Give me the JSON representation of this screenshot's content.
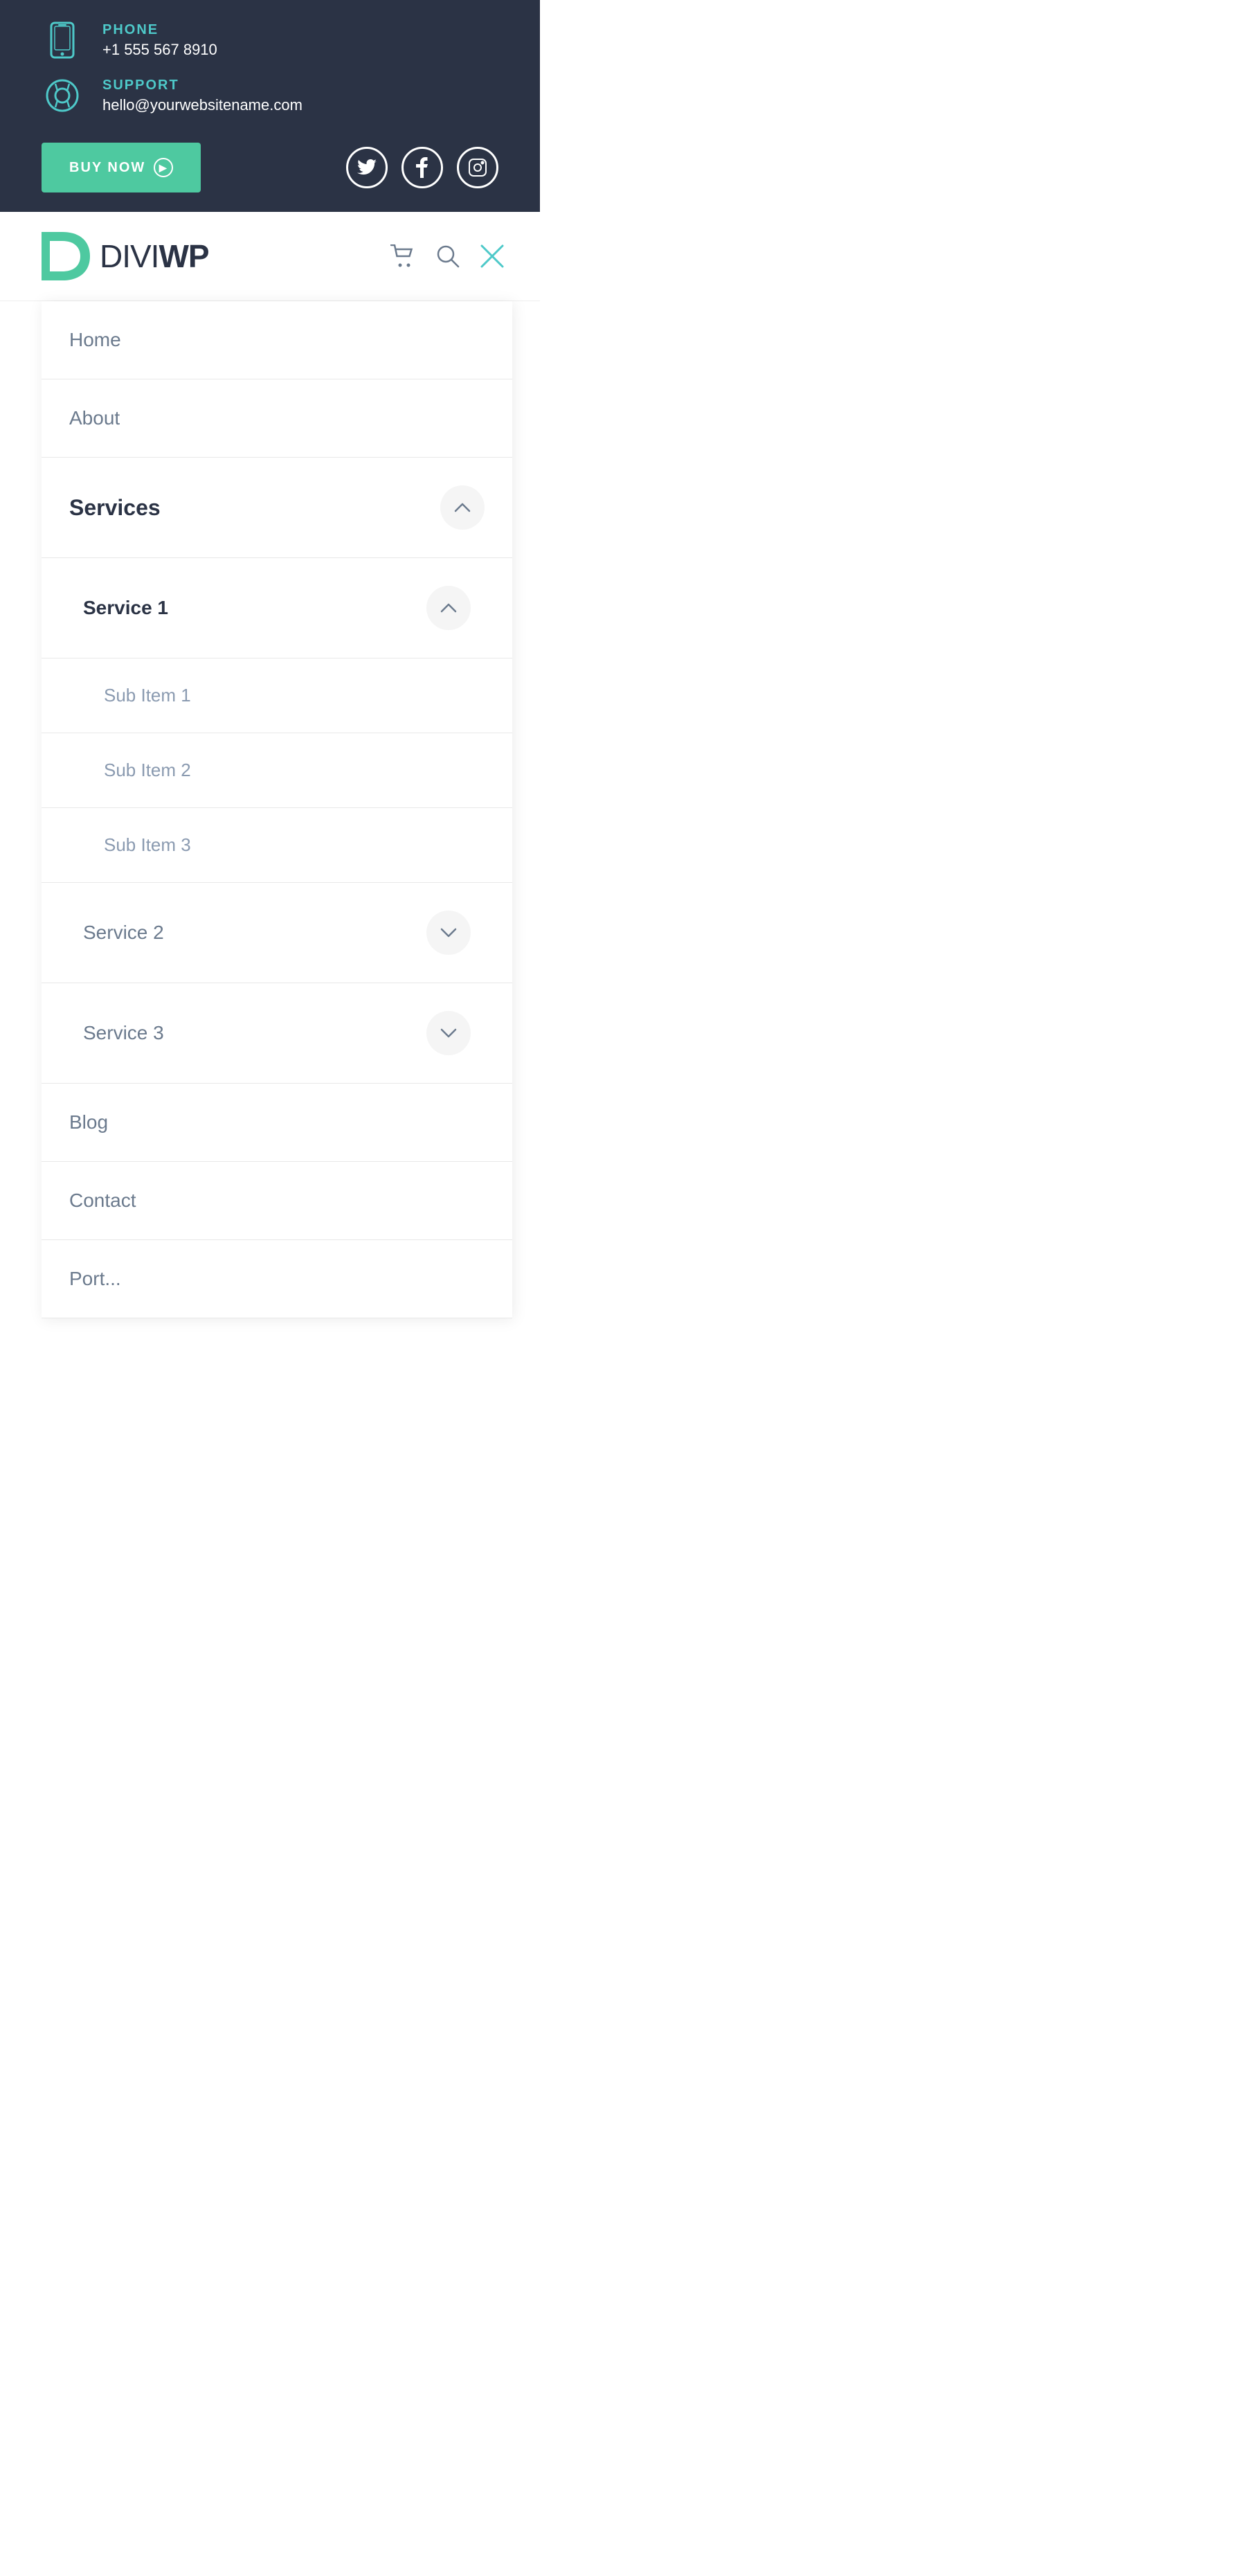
{
  "topbar": {
    "background": "#2b3345",
    "phone": {
      "label": "PHONE",
      "value": "+1 555 567 8910"
    },
    "support": {
      "label": "SUPPORT",
      "value": "hello@yourwebsitename.com"
    },
    "buy_now": "BUY NOW",
    "social": [
      "twitter",
      "facebook",
      "instagram"
    ]
  },
  "header": {
    "logo_divi": "DIVI",
    "logo_wp": "WP",
    "icons": [
      "cart",
      "search",
      "close"
    ]
  },
  "nav": {
    "items": [
      {
        "label": "Home",
        "has_toggle": false,
        "active": false
      },
      {
        "label": "About",
        "has_toggle": false,
        "active": false
      },
      {
        "label": "Services",
        "has_toggle": true,
        "open": true,
        "active": true,
        "children": [
          {
            "label": "Service 1",
            "has_toggle": true,
            "open": true,
            "children": [
              {
                "label": "Sub Item 1"
              },
              {
                "label": "Sub Item 2"
              },
              {
                "label": "Sub Item 3"
              }
            ]
          },
          {
            "label": "Service 2",
            "has_toggle": true,
            "open": false
          },
          {
            "label": "Service 3",
            "has_toggle": true,
            "open": false
          }
        ]
      },
      {
        "label": "Blog",
        "has_toggle": false,
        "active": false
      },
      {
        "label": "Contact",
        "has_toggle": false,
        "active": false
      },
      {
        "label": "Port...",
        "has_toggle": false,
        "active": false
      }
    ]
  }
}
